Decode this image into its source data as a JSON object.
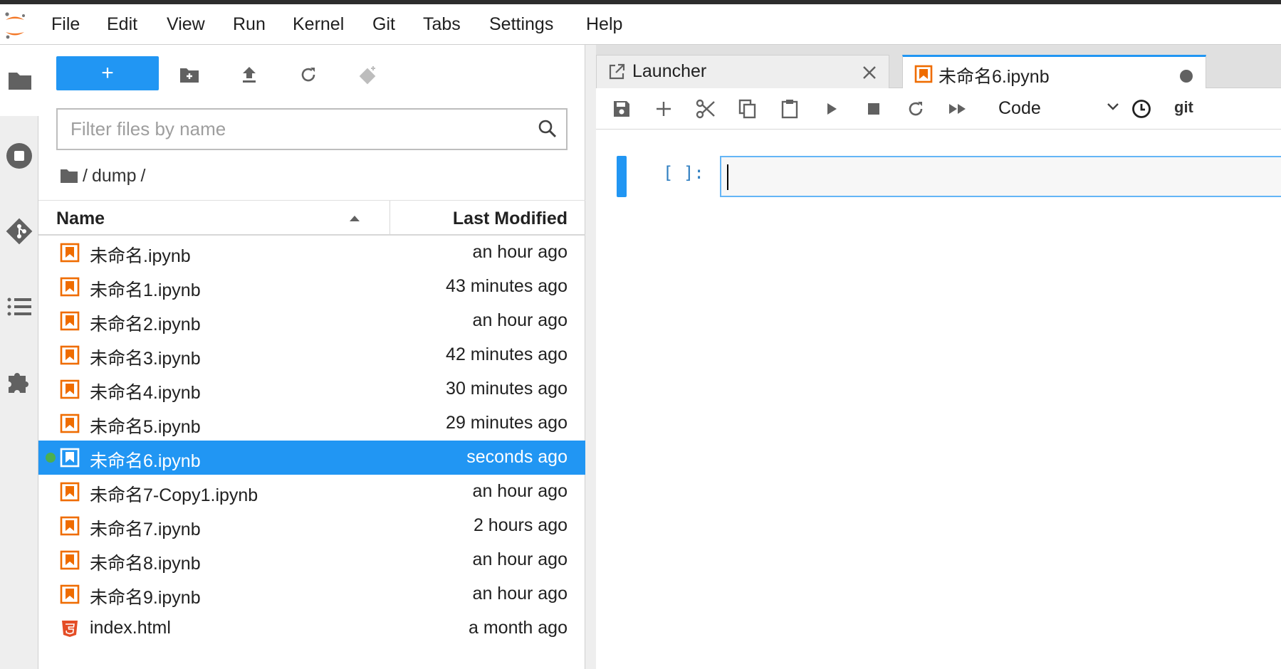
{
  "menubar": {
    "items": [
      "File",
      "Edit",
      "View",
      "Run",
      "Kernel",
      "Git",
      "Tabs",
      "Settings",
      "Help"
    ]
  },
  "sidebar": {
    "tabs": [
      "folder-icon",
      "running-icon",
      "git-icon",
      "toc-icon",
      "extension-icon"
    ],
    "active": "folder-icon"
  },
  "filebrowser": {
    "new_label": "+",
    "filter_placeholder": "Filter files by name",
    "filter_value": "",
    "breadcrumb": {
      "separator": "/",
      "folder": "dump"
    },
    "columns": {
      "name": "Name",
      "modified": "Last Modified"
    },
    "files": [
      {
        "name": "未命名.ipynb",
        "modified": "an hour ago",
        "type": "notebook"
      },
      {
        "name": "未命名1.ipynb",
        "modified": "43 minutes ago",
        "type": "notebook"
      },
      {
        "name": "未命名2.ipynb",
        "modified": "an hour ago",
        "type": "notebook"
      },
      {
        "name": "未命名3.ipynb",
        "modified": "42 minutes ago",
        "type": "notebook"
      },
      {
        "name": "未命名4.ipynb",
        "modified": "30 minutes ago",
        "type": "notebook"
      },
      {
        "name": "未命名5.ipynb",
        "modified": "29 minutes ago",
        "type": "notebook"
      },
      {
        "name": "未命名6.ipynb",
        "modified": "seconds ago",
        "type": "notebook",
        "selected": true,
        "running": true
      },
      {
        "name": "未命名7-Copy1.ipynb",
        "modified": "an hour ago",
        "type": "notebook"
      },
      {
        "name": "未命名7.ipynb",
        "modified": "2 hours ago",
        "type": "notebook"
      },
      {
        "name": "未命名8.ipynb",
        "modified": "an hour ago",
        "type": "notebook"
      },
      {
        "name": "未命名9.ipynb",
        "modified": "an hour ago",
        "type": "notebook"
      },
      {
        "name": "index.html",
        "modified": "a month ago",
        "type": "html"
      }
    ]
  },
  "tabs": [
    {
      "label": "Launcher",
      "icon": "launcher-icon",
      "active": false
    },
    {
      "label": "未命名6.ipynb",
      "icon": "notebook-icon",
      "active": true,
      "dirty": true
    }
  ],
  "notebook": {
    "cell_type": "Code",
    "git_label": "git",
    "prompt": "[ ]:"
  },
  "colors": {
    "accent": "#2196f3",
    "notebook_icon": "#ef6c00",
    "running": "#4caf50"
  }
}
